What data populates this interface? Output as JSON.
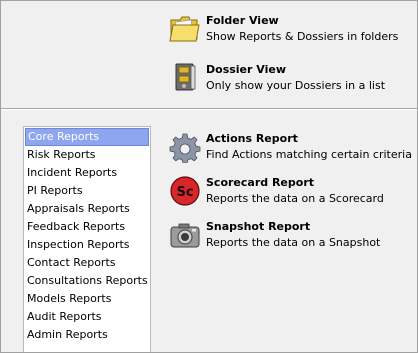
{
  "views": [
    {
      "title": "Folder View",
      "description": "Show Reports & Dossiers in folders",
      "icon": "folder-icon"
    },
    {
      "title": "Dossier View",
      "description": "Only show your Dossiers in a list",
      "icon": "dossier-binder-icon"
    }
  ],
  "report_list": {
    "selected_index": 0,
    "items": [
      "Core Reports",
      "Risk Reports",
      "Incident Reports",
      "PI Reports",
      "Appraisals Reports",
      "Feedback Reports",
      "Inspection Reports",
      "Contact Reports",
      "Consultations Reports",
      "Models Reports",
      "Audit Reports",
      "Admin Reports"
    ]
  },
  "report_options": [
    {
      "title": "Actions Report",
      "description": "Find Actions matching certain criteria",
      "icon": "gear-icon"
    },
    {
      "title": "Scorecard Report",
      "description": "Reports the data on a Scorecard",
      "icon": "scorecard-sc-icon",
      "icon_text": "Sc"
    },
    {
      "title": "Snapshot Report",
      "description": "Reports the data on a Snapshot",
      "icon": "camera-icon"
    }
  ],
  "colors": {
    "selection": "#8ea6ef",
    "scorecard_red": "#d8262a"
  }
}
